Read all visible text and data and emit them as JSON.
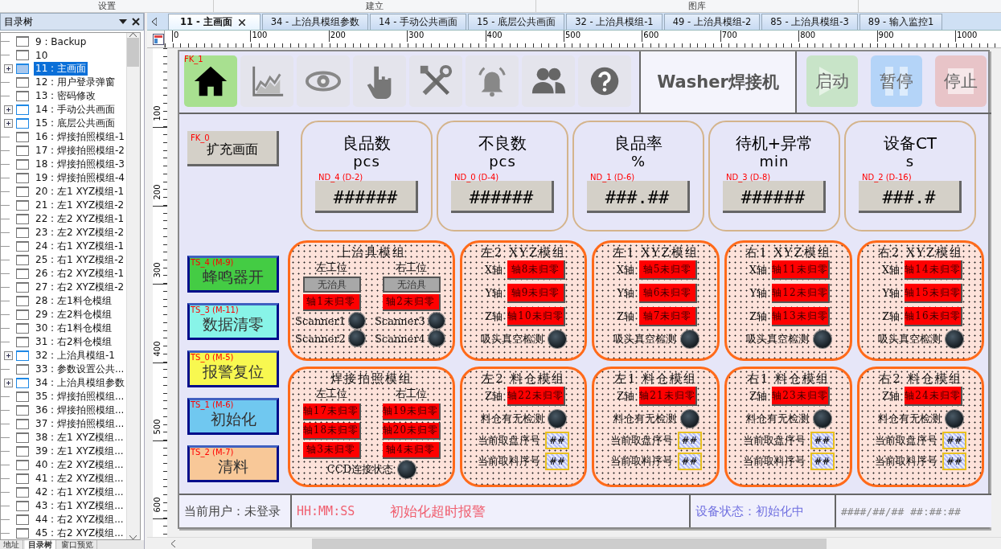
{
  "ribbon": [
    "设置",
    "建立",
    "图库"
  ],
  "tree": {
    "title": "目录树",
    "items": [
      {
        "label": "9 : Backup",
        "expandable": false,
        "selected": false
      },
      {
        "label": "10",
        "expandable": false,
        "selected": false
      },
      {
        "label": "11 : 主画面",
        "expandable": true,
        "selected": true
      },
      {
        "label": "12 : 用户登录弹窗",
        "expandable": false,
        "selected": false
      },
      {
        "label": "13 : 密码修改",
        "expandable": false,
        "selected": false
      },
      {
        "label": "14 : 手动公共画面",
        "expandable": true,
        "selected": false
      },
      {
        "label": "15 : 底层公共画面",
        "expandable": true,
        "selected": false
      },
      {
        "label": "16 : 焊接拍照模组-1",
        "expandable": false,
        "selected": false
      },
      {
        "label": "17 : 焊接拍照模组-2",
        "expandable": false,
        "selected": false
      },
      {
        "label": "18 : 焊接拍照模组-3",
        "expandable": false,
        "selected": false
      },
      {
        "label": "19 : 焊接拍照模组-4",
        "expandable": false,
        "selected": false
      },
      {
        "label": "20 : 左1 XYZ模组-1",
        "expandable": false,
        "selected": false
      },
      {
        "label": "21 : 左1 XYZ模组-2",
        "expandable": false,
        "selected": false
      },
      {
        "label": "22 : 左2 XYZ模组-1",
        "expandable": false,
        "selected": false
      },
      {
        "label": "23 : 左2 XYZ模组-2",
        "expandable": false,
        "selected": false
      },
      {
        "label": "24 : 右1 XYZ模组-1",
        "expandable": false,
        "selected": false
      },
      {
        "label": "25 : 右1 XYZ模组-2",
        "expandable": false,
        "selected": false
      },
      {
        "label": "26 : 右2 XYZ模组-1",
        "expandable": false,
        "selected": false
      },
      {
        "label": "27 : 右2 XYZ模组-2",
        "expandable": false,
        "selected": false
      },
      {
        "label": "28 : 左1料仓模组",
        "expandable": false,
        "selected": false
      },
      {
        "label": "29 : 左2料仓模组",
        "expandable": false,
        "selected": false
      },
      {
        "label": "30 : 右1料仓模组",
        "expandable": false,
        "selected": false
      },
      {
        "label": "31 : 右2料仓模组",
        "expandable": false,
        "selected": false
      },
      {
        "label": "32 : 上治具模组-1",
        "expandable": true,
        "selected": false
      },
      {
        "label": "33 : 参数设置公共...",
        "expandable": false,
        "selected": false
      },
      {
        "label": "34 : 上治具模组参数",
        "expandable": true,
        "selected": false
      },
      {
        "label": "35 : 焊接拍照模组...",
        "expandable": false,
        "selected": false
      },
      {
        "label": "36 : 焊接拍照模组...",
        "expandable": false,
        "selected": false
      },
      {
        "label": "37 : 焊接拍照模组...",
        "expandable": false,
        "selected": false
      },
      {
        "label": "38 : 左1 XYZ模组...",
        "expandable": false,
        "selected": false
      },
      {
        "label": "39 : 左1 XYZ模组...",
        "expandable": false,
        "selected": false
      },
      {
        "label": "40 : 左2 XYZ模组...",
        "expandable": false,
        "selected": false
      },
      {
        "label": "41 : 左2 XYZ模组...",
        "expandable": false,
        "selected": false
      },
      {
        "label": "42 : 右1 XYZ模组...",
        "expandable": false,
        "selected": false
      },
      {
        "label": "43 : 右1 XYZ模组...",
        "expandable": false,
        "selected": false
      },
      {
        "label": "44 : 右2 XYZ模组...",
        "expandable": false,
        "selected": false
      },
      {
        "label": "45 : 右2 XYZ模组...",
        "expandable": false,
        "selected": false
      }
    ]
  },
  "panel_tabs": [
    {
      "label": "地址",
      "selected": false
    },
    {
      "label": "目录树",
      "selected": true
    },
    {
      "label": "窗口预览",
      "selected": false
    }
  ],
  "tabs": [
    {
      "label": "11 - 主画面",
      "selected": true
    },
    {
      "label": "34 - 上治具模组参数",
      "selected": false
    },
    {
      "label": "14 - 手动公共画面",
      "selected": false
    },
    {
      "label": "15 - 底层公共画面",
      "selected": false
    },
    {
      "label": "32 - 上治具模组-1",
      "selected": false
    },
    {
      "label": "49 - 上治具模组-2",
      "selected": false
    },
    {
      "label": "85 - 上治具模组-3",
      "selected": false
    },
    {
      "label": "89 - 输入监控1",
      "selected": false
    }
  ],
  "ruler": {
    "x_ticks": [
      "0",
      "100",
      "200",
      "300",
      "400",
      "500",
      "600",
      "700",
      "800",
      "900",
      "1000"
    ],
    "y_ticks": [
      "100",
      "200",
      "300",
      "400",
      "500",
      "600"
    ]
  },
  "screen": {
    "toolbar": {
      "tag": "FK_1",
      "icons": [
        {
          "kind": "home",
          "selected": true
        },
        {
          "kind": "chart",
          "selected": false
        },
        {
          "kind": "eye",
          "selected": false
        },
        {
          "kind": "hand",
          "selected": false
        },
        {
          "kind": "tools",
          "selected": false
        },
        {
          "kind": "bell",
          "selected": false
        },
        {
          "kind": "users",
          "selected": false
        },
        {
          "kind": "help",
          "selected": false
        }
      ]
    },
    "title": "Washer焊接机",
    "controls": [
      {
        "kind": "start",
        "label": "启动",
        "color": "#c8e4c8"
      },
      {
        "kind": "pause",
        "label": "暂停",
        "color": "#b4d4f8"
      },
      {
        "kind": "stop",
        "label": "停止",
        "color": "#e8c4c8"
      }
    ],
    "expand_button": {
      "tag": "FK_0",
      "label": "扩充画面"
    },
    "stats": [
      {
        "title": "良品数",
        "unit": "pcs",
        "tag": "ND_4 (D-2)",
        "value": "######"
      },
      {
        "title": "不良数",
        "unit": "pcs",
        "tag": "ND_0 (D-4)",
        "value": "######"
      },
      {
        "title": "良品率",
        "unit": "%",
        "tag": "ND_1 (D-6)",
        "value": "###.##"
      },
      {
        "title": "待机+异常",
        "unit": "min",
        "tag": "ND_3 (D-8)",
        "value": "######"
      },
      {
        "title": "设备CT",
        "unit": "s",
        "tag": "ND_2 (D-16)",
        "value": "###.#"
      }
    ],
    "commands": [
      {
        "tag": "TS_4 (M-9)",
        "label": "蜂鸣器开",
        "color": "#44cc44"
      },
      {
        "tag": "TS_3 (M-11)",
        "label": "数据清零",
        "color": "#88f4e8"
      },
      {
        "tag": "TS_0 (M-5)",
        "label": "报警复位",
        "color": "#f8f850"
      },
      {
        "tag": "TS_1 (M-6)",
        "label": "初始化",
        "color": "#70c8f0"
      },
      {
        "tag": "TS_2 (M-7)",
        "label": "清料",
        "color": "#f8c898"
      }
    ],
    "modules": [
      {
        "kind": "fixture",
        "title": "上治具模组",
        "stations": [
          {
            "label": "左工位",
            "button": "无治具",
            "axis": "轴1未归零"
          },
          {
            "label": "右工位",
            "button": "无治具",
            "axis": "轴2未归零"
          }
        ],
        "sensors": [
          "Scanner1",
          "Scanner3",
          "Scanner2",
          "Scanner4"
        ]
      },
      {
        "kind": "xyz",
        "title": "左2 XYZ模组",
        "axes": [
          {
            "label": "X轴",
            "status": "轴8未归零"
          },
          {
            "label": "Y轴",
            "status": "轴9未归零"
          },
          {
            "label": "Z轴",
            "status": "轴10未归零"
          }
        ],
        "sensor": "吸头真空检测"
      },
      {
        "kind": "xyz",
        "title": "左1 XYZ模组",
        "axes": [
          {
            "label": "X轴",
            "status": "轴5未归零"
          },
          {
            "label": "Y轴",
            "status": "轴6未归零"
          },
          {
            "label": "Z轴",
            "status": "轴7未归零"
          }
        ],
        "sensor": "吸头真空检测"
      },
      {
        "kind": "xyz",
        "title": "右1 XYZ模组",
        "axes": [
          {
            "label": "X轴",
            "status": "轴11未归零"
          },
          {
            "label": "Y轴",
            "status": "轴12未归零"
          },
          {
            "label": "Z轴",
            "status": "轴13未归零"
          }
        ],
        "sensor": "吸头真空检测"
      },
      {
        "kind": "xyz",
        "title": "右2 XYZ模组",
        "axes": [
          {
            "label": "X轴",
            "status": "轴14未归零"
          },
          {
            "label": "Y轴",
            "status": "轴15未归零"
          },
          {
            "label": "Z轴",
            "status": "轴16未归零"
          }
        ],
        "sensor": "吸头真空检测"
      },
      {
        "kind": "camera",
        "title": "焊接拍照模组",
        "stations": [
          {
            "label": "左工位",
            "axes": [
              "轴17未归零",
              "轴18未归零",
              "轴3未归零"
            ]
          },
          {
            "label": "右工位",
            "axes": [
              "轴19未归零",
              "轴20未归零",
              "轴4未归零"
            ]
          }
        ],
        "sensor": "CCD连接状态"
      },
      {
        "kind": "bin",
        "title": "左2 料仓模组",
        "axes": [
          {
            "label": "Z轴",
            "status": "轴22未归零"
          }
        ],
        "sensor": "料仓有无检测",
        "counters": [
          {
            "label": "当前取盘序号",
            "value": "##"
          },
          {
            "label": "当前取料序号",
            "value": "##"
          }
        ]
      },
      {
        "kind": "bin",
        "title": "左1 料仓模组",
        "axes": [
          {
            "label": "Z轴",
            "status": "轴21未归零"
          }
        ],
        "sensor": "料仓有无检测",
        "counters": [
          {
            "label": "当前取盘序号",
            "value": "##"
          },
          {
            "label": "当前取料序号",
            "value": "##"
          }
        ]
      },
      {
        "kind": "bin",
        "title": "右1 料仓模组",
        "axes": [
          {
            "label": "Z轴",
            "status": "轴23未归零"
          }
        ],
        "sensor": "料仓有无检测",
        "counters": [
          {
            "label": "当前取盘序号",
            "value": "##"
          },
          {
            "label": "当前取料序号",
            "value": "##"
          }
        ]
      },
      {
        "kind": "bin",
        "title": "右2 料仓模组",
        "axes": [
          {
            "label": "Z轴",
            "status": "轴24未归零"
          }
        ],
        "sensor": "料仓有无检测",
        "counters": [
          {
            "label": "当前取盘序号",
            "value": "##"
          },
          {
            "label": "当前取料序号",
            "value": "##"
          }
        ]
      }
    ],
    "status_bar": {
      "user": "当前用户：未登录",
      "time": "HH:MM:SS",
      "alarm": "初始化超时报警",
      "state": "设备状态：初始化中",
      "date": "####/##/##",
      "clock": "##:##:##"
    }
  }
}
